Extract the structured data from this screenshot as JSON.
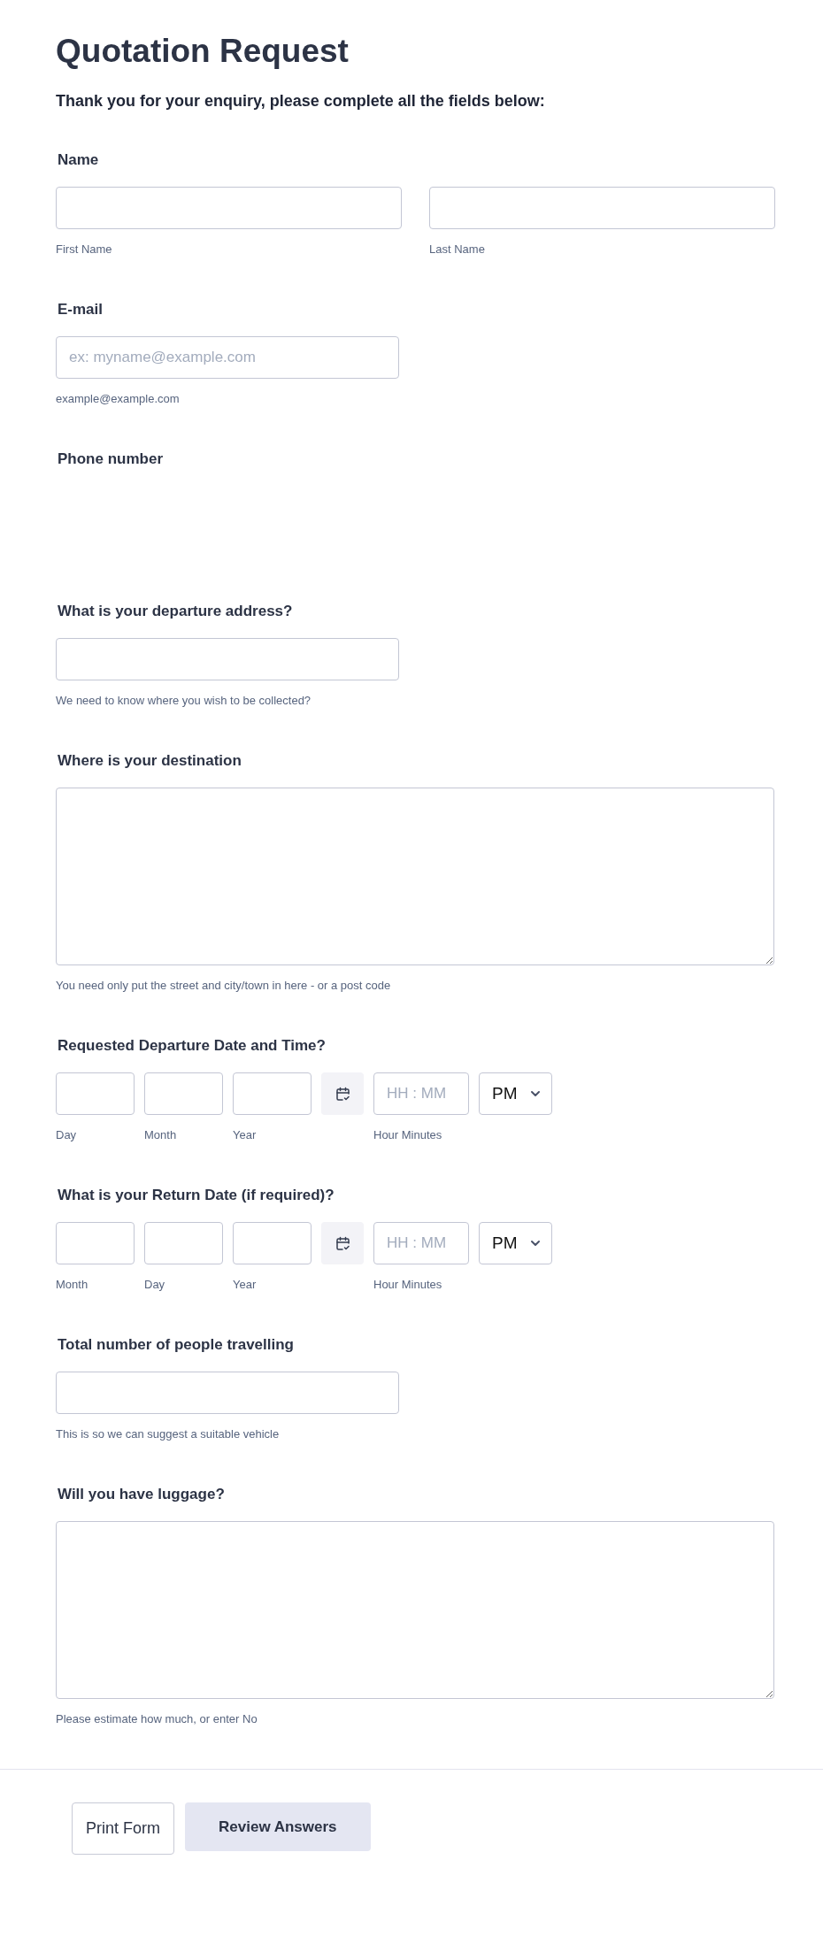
{
  "form": {
    "title": "Quotation Request",
    "intro": "Thank you for your enquiry, please complete all the fields below:",
    "questions": [
      {
        "kind": "pair",
        "label": "Name",
        "inputs": [
          {
            "sublabel": "First Name"
          },
          {
            "sublabel": "Last Name"
          }
        ]
      },
      {
        "kind": "text",
        "label": "E-mail",
        "placeholder": "ex: myname@example.com",
        "hint": "example@example.com"
      },
      {
        "kind": "blank",
        "label": "Phone number"
      },
      {
        "kind": "text",
        "label": "What is your departure address?",
        "hint": "We need to know where you wish to be collected?"
      },
      {
        "kind": "textarea",
        "label": "Where is your destination",
        "hint": "You need only put the street and city/town in here - or a post code"
      },
      {
        "kind": "datetime",
        "label": "Requested Departure Date and Time?",
        "date_parts": [
          {
            "sublabel": "Day"
          },
          {
            "sublabel": "Month"
          },
          {
            "sublabel": "Year"
          }
        ],
        "time_placeholder": "HH : MM",
        "time_sublabel": "Hour Minutes",
        "period": "PM"
      },
      {
        "kind": "datetime",
        "label": "What is your Return Date (if required)?",
        "date_parts": [
          {
            "sublabel": "Month"
          },
          {
            "sublabel": "Day"
          },
          {
            "sublabel": "Year"
          }
        ],
        "time_placeholder": "HH : MM",
        "time_sublabel": "Hour Minutes",
        "period": "PM"
      },
      {
        "kind": "text",
        "label": "Total number of people travelling",
        "hint": "This is so we can suggest a suitable vehicle"
      },
      {
        "kind": "textarea",
        "label": "Will you have luggage?",
        "hint": "Please estimate how much, or enter No"
      }
    ]
  },
  "buttons": [
    {
      "kind": "outline",
      "label": "Print Form"
    },
    {
      "kind": "filled",
      "label": "Review Answers"
    }
  ]
}
